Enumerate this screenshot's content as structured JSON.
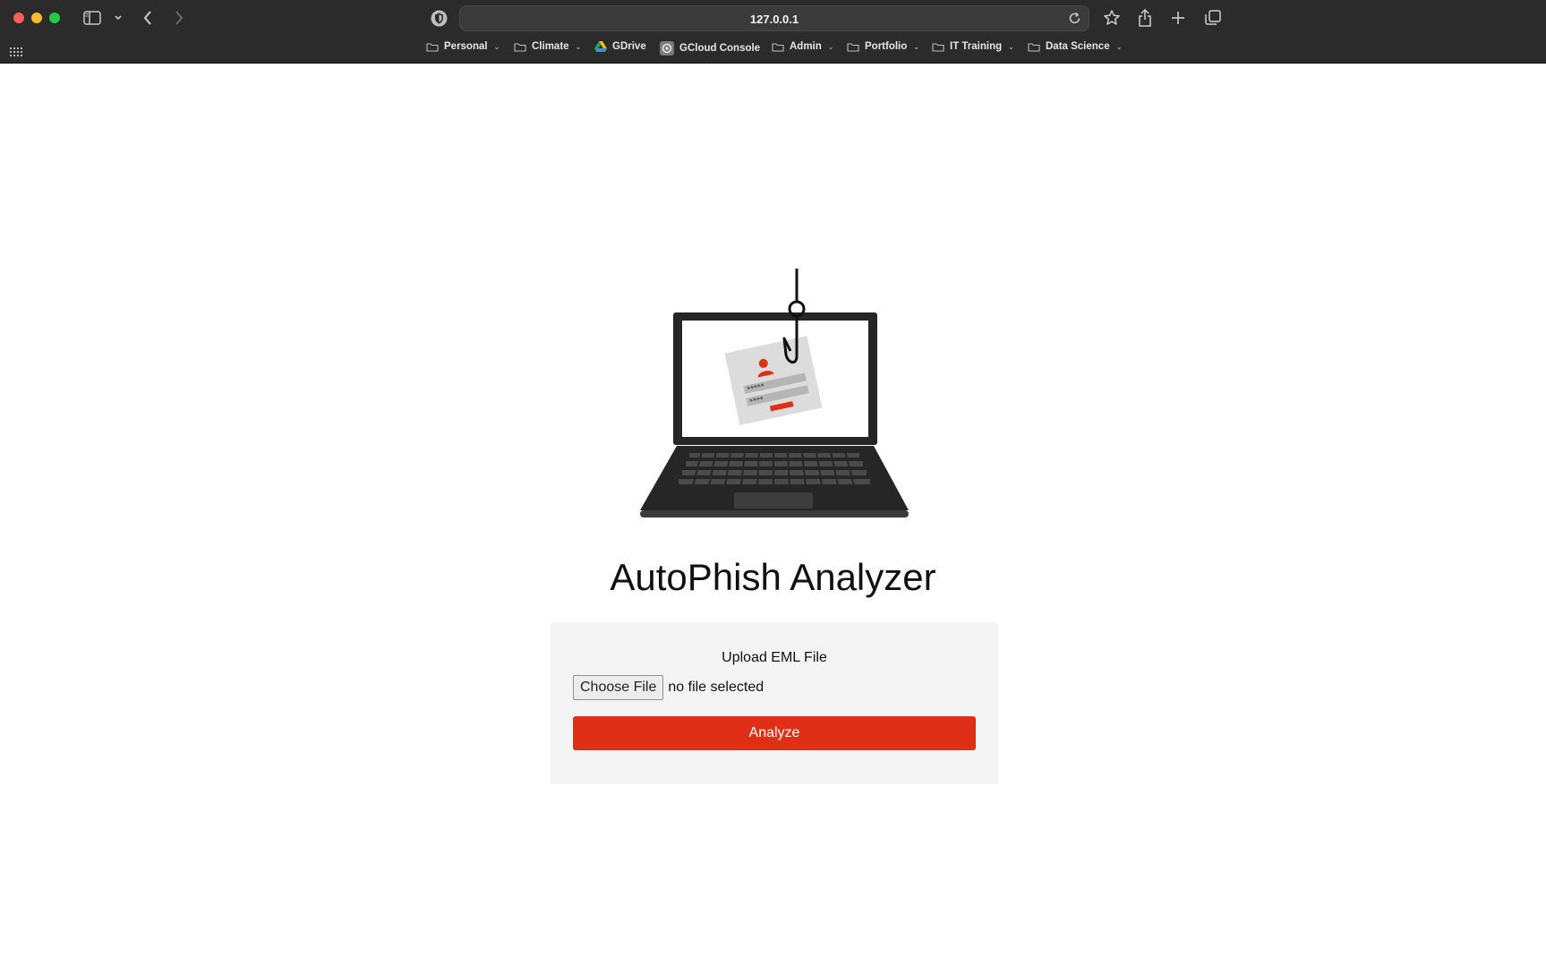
{
  "browser": {
    "url": "127.0.0.1",
    "bookmarks": [
      {
        "label": "Personal",
        "icon": "folder-icon",
        "has_menu": true
      },
      {
        "label": "Climate",
        "icon": "folder-icon",
        "has_menu": true
      },
      {
        "label": "GDrive",
        "icon": "gdrive-icon",
        "has_menu": false
      },
      {
        "label": "GCloud Console",
        "icon": "gcloud-icon",
        "has_menu": false
      },
      {
        "label": "Admin",
        "icon": "folder-icon",
        "has_menu": true
      },
      {
        "label": "Portfolio",
        "icon": "folder-icon",
        "has_menu": true
      },
      {
        "label": "IT Training",
        "icon": "folder-icon",
        "has_menu": true
      },
      {
        "label": "Data Science",
        "icon": "folder-icon",
        "has_menu": true
      }
    ]
  },
  "app": {
    "title": "AutoPhish Analyzer",
    "upload_label": "Upload EML File",
    "choose_file_label": "Choose File",
    "file_status": "no file selected",
    "analyze_label": "Analyze",
    "accent_color": "#df3017"
  }
}
